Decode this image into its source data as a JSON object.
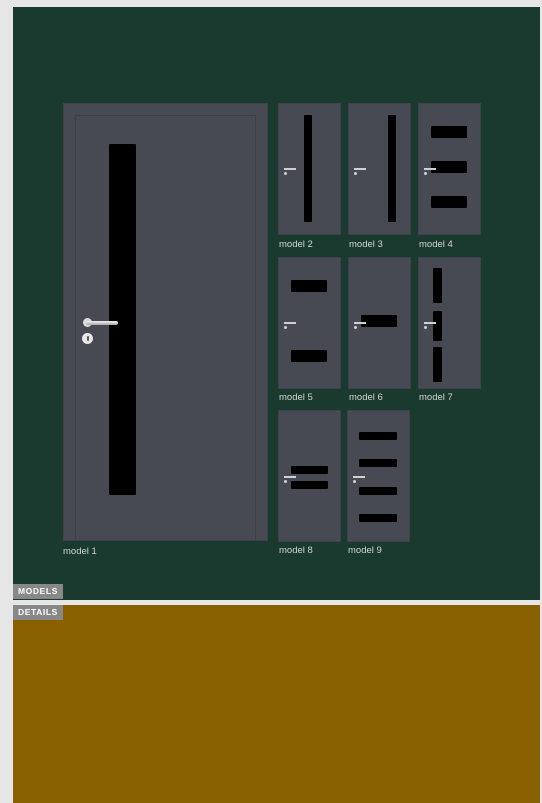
{
  "panels": {
    "models_color": "#1a3a30",
    "details_color": "#8a6100"
  },
  "tabs": {
    "models": "MODELS",
    "details": "DETAILS"
  },
  "door_color": "#474a52",
  "models": [
    {
      "id": 1,
      "label": "model 1"
    },
    {
      "id": 2,
      "label": "model 2"
    },
    {
      "id": 3,
      "label": "model 3"
    },
    {
      "id": 4,
      "label": "model 4"
    },
    {
      "id": 5,
      "label": "model 5"
    },
    {
      "id": 6,
      "label": "model 6"
    },
    {
      "id": 7,
      "label": "model 7"
    },
    {
      "id": 8,
      "label": "model 8"
    },
    {
      "id": 9,
      "label": "model 9"
    }
  ]
}
